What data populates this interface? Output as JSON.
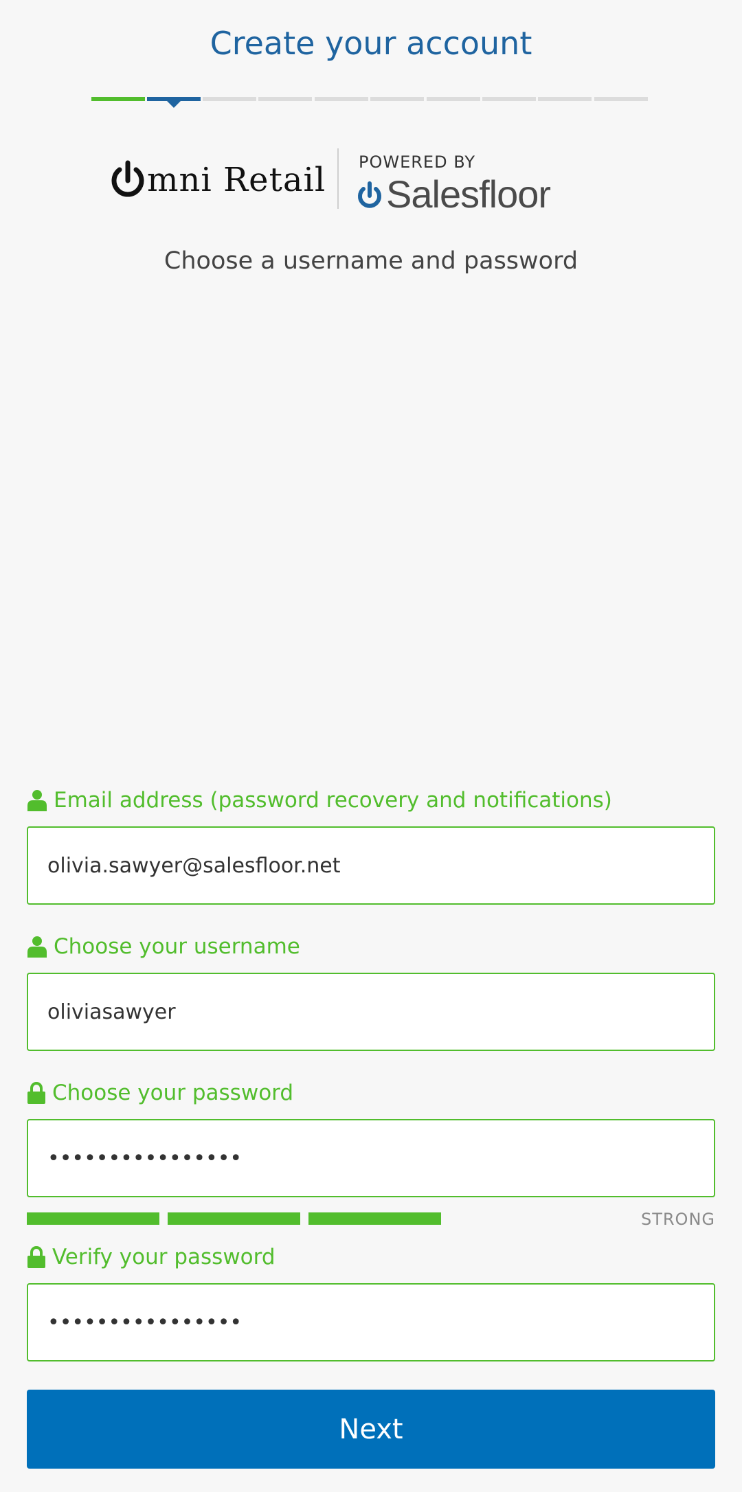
{
  "header": {
    "title": "Create your account",
    "steps": {
      "total": 10,
      "completed": 1,
      "current": 2
    }
  },
  "branding": {
    "retailer_logo_text": "mni Retail",
    "powered_by": "POWERED BY",
    "platform_logo_text": "Salesfloor"
  },
  "subtitle": "Choose a username and password",
  "form": {
    "email": {
      "label": "Email address (password recovery and notifications)",
      "value": "olivia.sawyer@salesfloor.net",
      "icon": "user-icon"
    },
    "username": {
      "label": "Choose your username",
      "value": "oliviasawyer",
      "icon": "user-icon"
    },
    "password": {
      "label": "Choose your password",
      "value": "••••••••••••••••",
      "icon": "lock-icon",
      "strength_label": "STRONG",
      "strength_filled": 3
    },
    "verify_password": {
      "label": "Verify your password",
      "value": "••••••••••••••••",
      "icon": "lock-icon"
    }
  },
  "next_label": "Next",
  "colors": {
    "accent_green": "#52bd2d",
    "title_blue": "#1f64a0",
    "button_blue": "#0070ba",
    "step_inactive": "#dcdcdc"
  }
}
